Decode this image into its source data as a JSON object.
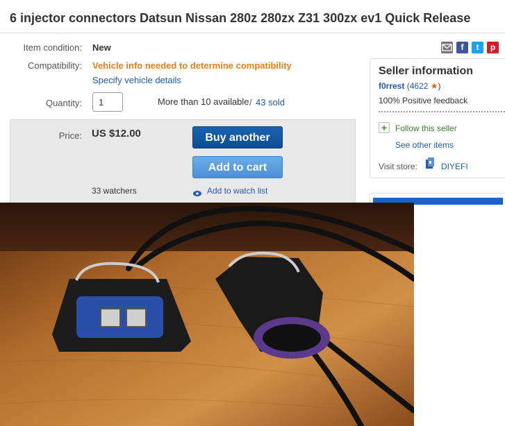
{
  "listing": {
    "title": "6 injector connectors Datsun Nissan 280z 280zx Z31 300zx ev1 Quick Release"
  },
  "details": {
    "condition_label": "Item condition:",
    "condition_value": "New",
    "compat_label": "Compatibility:",
    "compat_value": "Vehicle info needed to determine compatibility",
    "compat_link": "Specify vehicle details",
    "quantity_label": "Quantity:",
    "quantity_value": "1",
    "available_text": "More than 10 available",
    "sold_text": "43 sold",
    "sold_sep": "/"
  },
  "pricing": {
    "price_label": "Price:",
    "price_value": "US $12.00",
    "buy_button": "Buy another",
    "cart_button": "Add to cart",
    "watchers": "33 watchers",
    "watch_link": "Add to watch list"
  },
  "seller": {
    "title": "Seller information",
    "name": "f0rrest",
    "feedback_count": "(4622",
    "feedback_close": ")",
    "positive": "100% Positive feedback",
    "follow": "Follow this seller",
    "other_items": "See other items",
    "store_label": "Visit store:",
    "store_name": "DIYEFI"
  },
  "share": {
    "icons": [
      "email-icon",
      "facebook-icon",
      "twitter-icon",
      "pinterest-icon"
    ],
    "facebook_glyph": "f",
    "twitter_glyph": "t",
    "pinterest_glyph": "p"
  },
  "colors": {
    "link": "#2559ac",
    "orange": "#e57f1a",
    "buy_button": "#0b4d94",
    "cart_button": "#4a90d6",
    "facebook": "#3b5998",
    "twitter": "#1da1f2",
    "pinterest": "#cb2027",
    "email": "#777777",
    "star": "#e0621c",
    "follow_plus": "#3c9a2c"
  },
  "photo": {
    "subject": "two fuel injector connectors with wires"
  }
}
